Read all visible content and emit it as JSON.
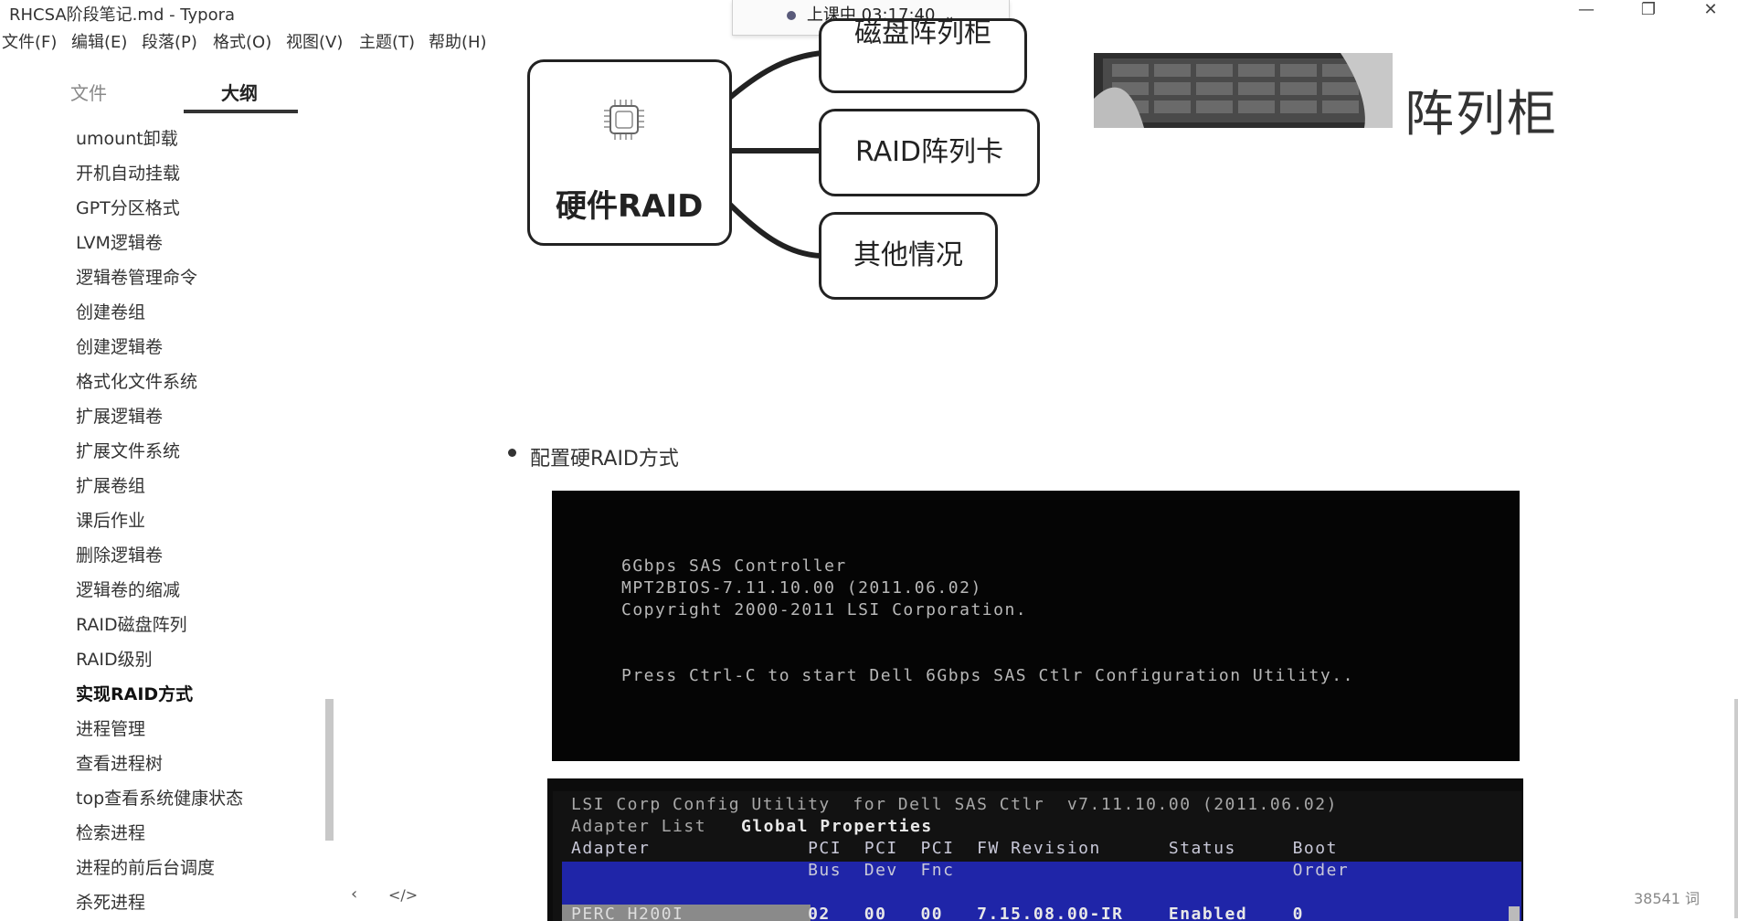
{
  "window": {
    "title": "RHCSA阶段笔记.md - Typora",
    "minimize": "—",
    "maximize": "❐",
    "close": "✕"
  },
  "timer": {
    "label": "上课中 03:17:40",
    "chevron": "⌄"
  },
  "menu": [
    "文件(F)",
    "编辑(E)",
    "段落(P)",
    "格式(O)",
    "视图(V)",
    "主题(T)",
    "帮助(H)"
  ],
  "sidebar": {
    "tabs": {
      "files": "文件",
      "outline": "大纲"
    },
    "outline_items": [
      "umount卸载",
      "开机自动挂载",
      "GPT分区格式",
      "LVM逻辑卷",
      "逻辑卷管理命令",
      "创建卷组",
      "创建逻辑卷",
      "格式化文件系统",
      "扩展逻辑卷",
      "扩展文件系统",
      "扩展卷组",
      "课后作业",
      "删除逻辑卷",
      "逻辑卷的缩减",
      "RAID磁盘阵列",
      "RAID级别",
      "实现RAID方式",
      "进程管理",
      "查看进程树",
      "top查看系统健康状态",
      "检索进程",
      "进程的前后台调度",
      "杀死进程"
    ],
    "active_item": "实现RAID方式",
    "footer": {
      "back": "‹",
      "source": "</>"
    }
  },
  "mindmap": {
    "root": "硬件RAID",
    "nodes": [
      "磁盘阵列柜",
      "RAID阵列卡",
      "其他情况"
    ]
  },
  "photo_caption": "阵列柜",
  "content": {
    "bullet": "配置硬RAID方式"
  },
  "bios_screen_1": {
    "lines": [
      "6Gbps SAS Controller",
      "MPT2BIOS-7.11.10.00 (2011.06.02)",
      "Copyright 2000-2011 LSI Corporation.",
      "Press Ctrl-C to start Dell 6Gbps SAS Ctlr Configuration Utility.."
    ]
  },
  "bios_screen_2": {
    "title": "LSI Corp Config Utility  for Dell SAS Ctlr  v7.11.10.00 (2011.06.02)",
    "subtitle_left": "Adapter List",
    "subtitle_right": "Global Properties",
    "header_row1": "Adapter              PCI  PCI  PCI  FW Revision      Status     Boot",
    "header_row2": "                     Bus  Dev  Fnc                              Order",
    "data_row": "                     02   00   00   7.15.08.00-IR    Enabled    0",
    "selected_adapter": "PERC H200I"
  },
  "status": {
    "word_count": "38541 词"
  }
}
